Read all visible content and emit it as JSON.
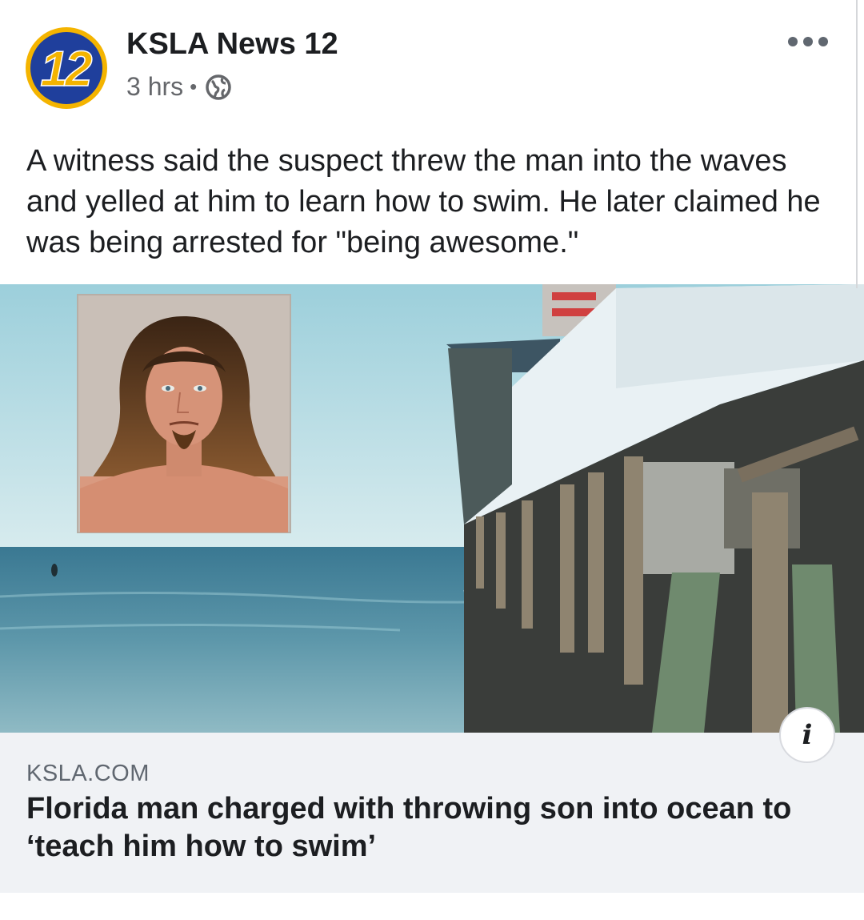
{
  "post": {
    "page_name": "KSLA News 12",
    "avatar_text": "12",
    "timestamp": "3 hrs",
    "separator": "•",
    "audience_icon": "globe-icon",
    "more_icon": "more-options-icon",
    "text": "A witness said the suspect threw the man into the waves and yelled at him to learn how to swim. He later claimed he was being arrested for \"being awesome.\""
  },
  "link_preview": {
    "domain": "KSLA.COM",
    "headline": "Florida man charged with throwing son into ocean to ‘teach him how to swim’",
    "info_icon": "info-icon",
    "info_glyph": "i"
  },
  "colors": {
    "logo_blue": "#1f3f9c",
    "logo_yellow": "#f4b400",
    "meta_gray": "#65676b",
    "link_bg": "#f0f2f5",
    "sky": "#a9d2dc",
    "sea": "#3f7f96"
  }
}
